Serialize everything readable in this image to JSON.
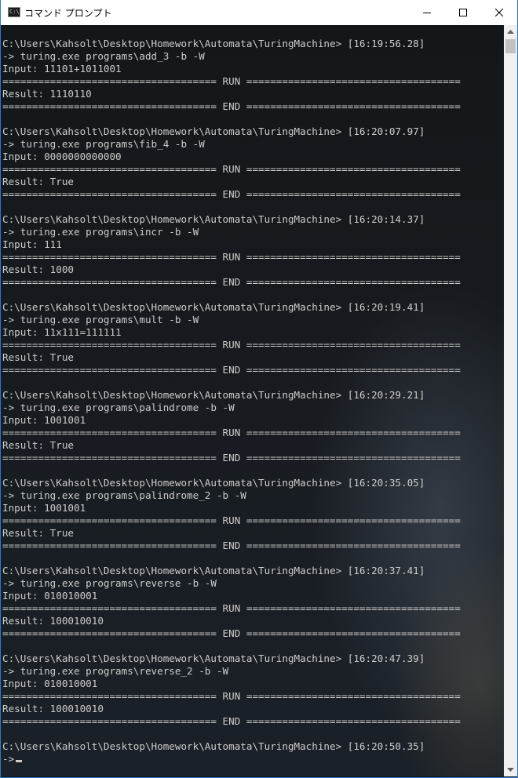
{
  "window": {
    "title": "コマンド プロンプト",
    "icon_glyph": "C:\\.",
    "controls": {
      "minimize": "minimize-icon",
      "maximize": "maximize-icon",
      "close": "close-icon"
    }
  },
  "console": {
    "lines": [
      "C:\\Users\\Kahsolt\\Desktop\\Homework\\Automata\\TuringMachine> [16:19:56.28]",
      "-> turing.exe programs\\add_3 -b -W",
      "Input: 11101+1011001",
      "==================================== RUN ====================================",
      "Result: 1110110",
      "==================================== END ====================================",
      "",
      "C:\\Users\\Kahsolt\\Desktop\\Homework\\Automata\\TuringMachine> [16:20:07.97]",
      "-> turing.exe programs\\fib_4 -b -W",
      "Input: 0000000000000",
      "==================================== RUN ====================================",
      "Result: True",
      "==================================== END ====================================",
      "",
      "C:\\Users\\Kahsolt\\Desktop\\Homework\\Automata\\TuringMachine> [16:20:14.37]",
      "-> turing.exe programs\\incr -b -W",
      "Input: 111",
      "==================================== RUN ====================================",
      "Result: 1000",
      "==================================== END ====================================",
      "",
      "C:\\Users\\Kahsolt\\Desktop\\Homework\\Automata\\TuringMachine> [16:20:19.41]",
      "-> turing.exe programs\\mult -b -W",
      "Input: 11x111=111111",
      "==================================== RUN ====================================",
      "Result: True",
      "==================================== END ====================================",
      "",
      "C:\\Users\\Kahsolt\\Desktop\\Homework\\Automata\\TuringMachine> [16:20:29.21]",
      "-> turing.exe programs\\palindrome -b -W",
      "Input: 1001001",
      "==================================== RUN ====================================",
      "Result: True",
      "==================================== END ====================================",
      "",
      "C:\\Users\\Kahsolt\\Desktop\\Homework\\Automata\\TuringMachine> [16:20:35.05]",
      "-> turing.exe programs\\palindrome_2 -b -W",
      "Input: 1001001",
      "==================================== RUN ====================================",
      "Result: True",
      "==================================== END ====================================",
      "",
      "C:\\Users\\Kahsolt\\Desktop\\Homework\\Automata\\TuringMachine> [16:20:37.41]",
      "-> turing.exe programs\\reverse -b -W",
      "Input: 010010001",
      "==================================== RUN ====================================",
      "Result: 100010010",
      "==================================== END ====================================",
      "",
      "C:\\Users\\Kahsolt\\Desktop\\Homework\\Automata\\TuringMachine> [16:20:47.39]",
      "-> turing.exe programs\\reverse_2 -b -W",
      "Input: 010010001",
      "==================================== RUN ====================================",
      "Result: 100010010",
      "==================================== END ====================================",
      "",
      "C:\\Users\\Kahsolt\\Desktop\\Homework\\Automata\\TuringMachine> [16:20:50.35]"
    ],
    "prompt": "->",
    "text_color": "#cccccc",
    "background_color": "#121519"
  },
  "scrollbar": {
    "up_icon": "scroll-up-arrow-icon",
    "down_icon": "scroll-down-arrow-icon"
  }
}
